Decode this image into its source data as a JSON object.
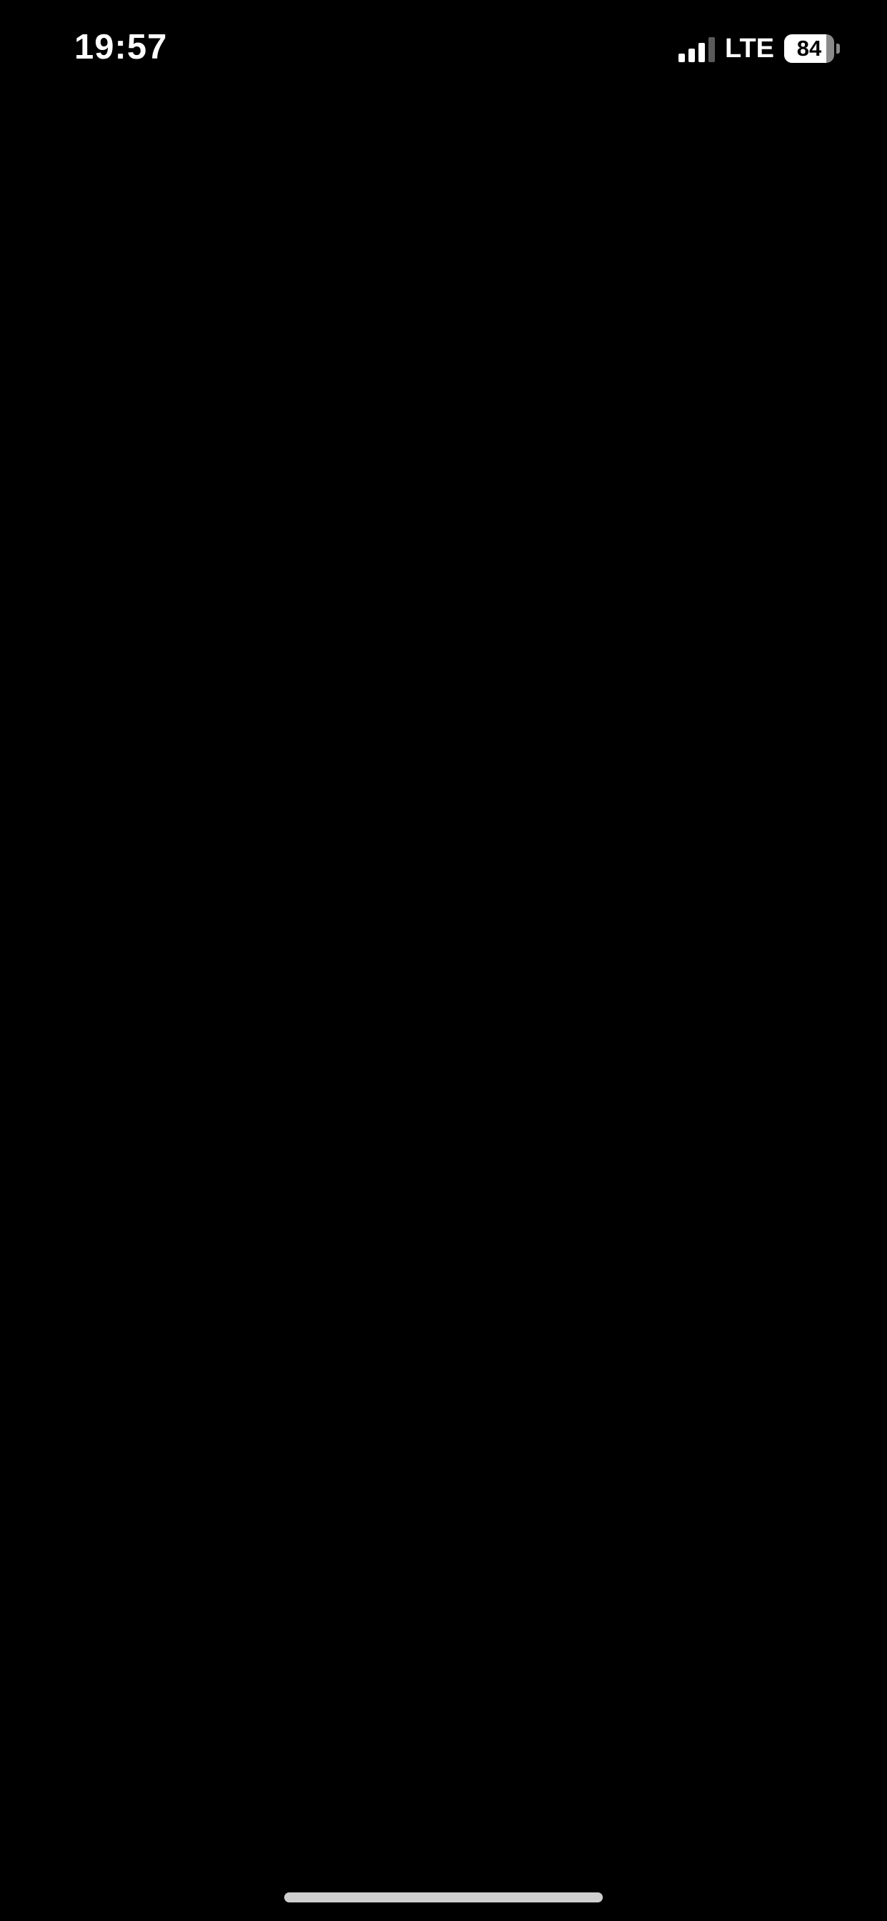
{
  "status_bar": {
    "time": "19:57",
    "network": "LTE",
    "signal_bars_active": 3,
    "signal_bars_total": 4,
    "battery_level": "84",
    "battery_percent": 84
  },
  "colors": {
    "background": "#000000",
    "foreground": "#ffffff",
    "home_indicator": "#cfcfcf"
  },
  "icons": {
    "signal": "cellular-signal-icon",
    "battery": "battery-icon"
  }
}
